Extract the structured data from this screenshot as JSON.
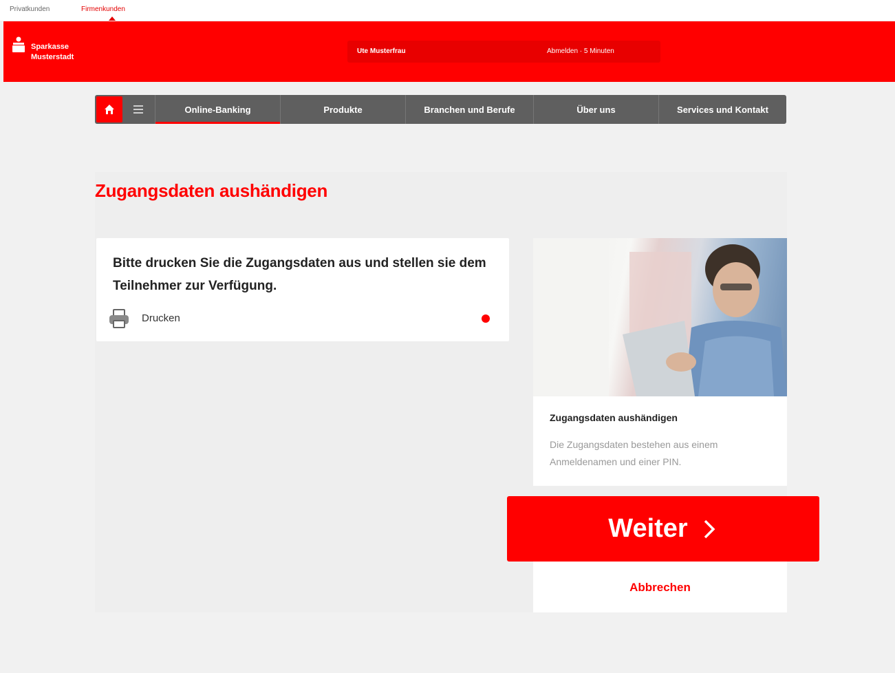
{
  "segments": {
    "private": "Privatkunden",
    "business": "Firmenkunden"
  },
  "header": {
    "logo_line1": "Sparkasse",
    "logo_line2": "Musterstadt",
    "user_name": "Ute Musterfrau",
    "session_info": "Abmelden · 5 Minuten"
  },
  "nav": {
    "items": [
      {
        "label": "Online-Banking",
        "active": true
      },
      {
        "label": "Produkte"
      },
      {
        "label": "Branchen und Berufe"
      },
      {
        "label": "Über uns"
      },
      {
        "label": "Services und Kontakt"
      }
    ]
  },
  "page": {
    "title": "Zugangsdaten aushändigen"
  },
  "instruction_card": {
    "text": "Bitte drucken Sie die Zugangsdaten aus und stellen sie dem Teilnehmer zur Verfügung.",
    "print_label": "Drucken"
  },
  "info_card": {
    "title": "Zugangsdaten aushändigen",
    "description": "Die Zugangsdaten bestehen aus einem Anmeldenamen und einer PIN."
  },
  "actions": {
    "next": "Weiter",
    "cancel": "Abbrechen"
  },
  "colors": {
    "brand": "#ff0000",
    "nav_bg": "#5f5f5f",
    "page_bg": "#f1f1f1"
  }
}
